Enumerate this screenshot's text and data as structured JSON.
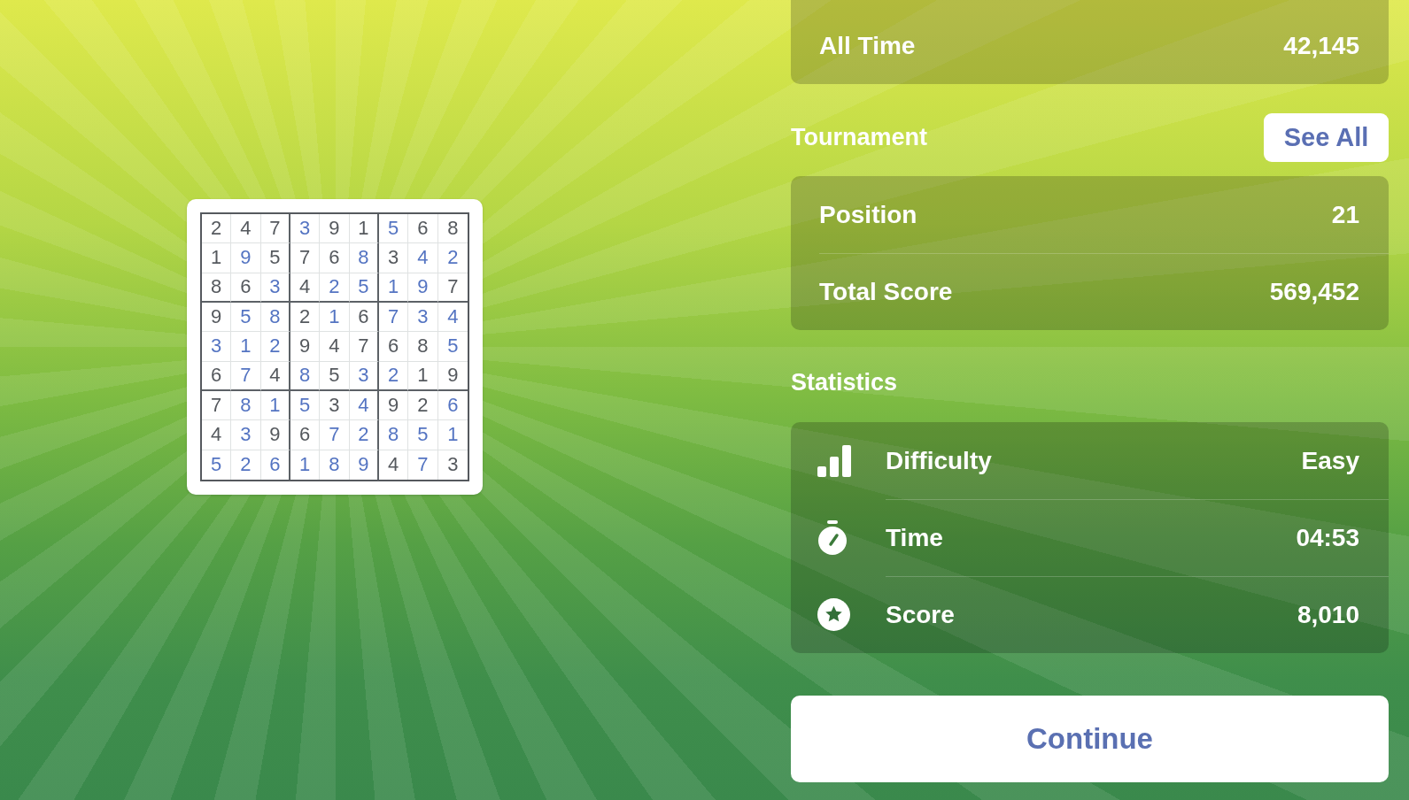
{
  "puzzle": {
    "rows": [
      [
        {
          "digit": "2",
          "given": true
        },
        {
          "digit": "4",
          "given": true
        },
        {
          "digit": "7",
          "given": true
        },
        {
          "digit": "3",
          "given": false
        },
        {
          "digit": "9",
          "given": true
        },
        {
          "digit": "1",
          "given": true
        },
        {
          "digit": "5",
          "given": false
        },
        {
          "digit": "6",
          "given": true
        },
        {
          "digit": "8",
          "given": true
        }
      ],
      [
        {
          "digit": "1",
          "given": true
        },
        {
          "digit": "9",
          "given": false
        },
        {
          "digit": "5",
          "given": true
        },
        {
          "digit": "7",
          "given": true
        },
        {
          "digit": "6",
          "given": true
        },
        {
          "digit": "8",
          "given": false
        },
        {
          "digit": "3",
          "given": true
        },
        {
          "digit": "4",
          "given": false
        },
        {
          "digit": "2",
          "given": false
        }
      ],
      [
        {
          "digit": "8",
          "given": true
        },
        {
          "digit": "6",
          "given": true
        },
        {
          "digit": "3",
          "given": false
        },
        {
          "digit": "4",
          "given": true
        },
        {
          "digit": "2",
          "given": false
        },
        {
          "digit": "5",
          "given": false
        },
        {
          "digit": "1",
          "given": false
        },
        {
          "digit": "9",
          "given": false
        },
        {
          "digit": "7",
          "given": true
        }
      ],
      [
        {
          "digit": "9",
          "given": true
        },
        {
          "digit": "5",
          "given": false
        },
        {
          "digit": "8",
          "given": false
        },
        {
          "digit": "2",
          "given": true
        },
        {
          "digit": "1",
          "given": false
        },
        {
          "digit": "6",
          "given": true
        },
        {
          "digit": "7",
          "given": false
        },
        {
          "digit": "3",
          "given": false
        },
        {
          "digit": "4",
          "given": false
        }
      ],
      [
        {
          "digit": "3",
          "given": false
        },
        {
          "digit": "1",
          "given": false
        },
        {
          "digit": "2",
          "given": false
        },
        {
          "digit": "9",
          "given": true
        },
        {
          "digit": "4",
          "given": true
        },
        {
          "digit": "7",
          "given": true
        },
        {
          "digit": "6",
          "given": true
        },
        {
          "digit": "8",
          "given": true
        },
        {
          "digit": "5",
          "given": false
        }
      ],
      [
        {
          "digit": "6",
          "given": true
        },
        {
          "digit": "7",
          "given": false
        },
        {
          "digit": "4",
          "given": true
        },
        {
          "digit": "8",
          "given": false
        },
        {
          "digit": "5",
          "given": true
        },
        {
          "digit": "3",
          "given": false
        },
        {
          "digit": "2",
          "given": false
        },
        {
          "digit": "1",
          "given": true
        },
        {
          "digit": "9",
          "given": true
        }
      ],
      [
        {
          "digit": "7",
          "given": true
        },
        {
          "digit": "8",
          "given": false
        },
        {
          "digit": "1",
          "given": false
        },
        {
          "digit": "5",
          "given": false
        },
        {
          "digit": "3",
          "given": true
        },
        {
          "digit": "4",
          "given": false
        },
        {
          "digit": "9",
          "given": true
        },
        {
          "digit": "2",
          "given": true
        },
        {
          "digit": "6",
          "given": false
        }
      ],
      [
        {
          "digit": "4",
          "given": true
        },
        {
          "digit": "3",
          "given": false
        },
        {
          "digit": "9",
          "given": true
        },
        {
          "digit": "6",
          "given": true
        },
        {
          "digit": "7",
          "given": false
        },
        {
          "digit": "2",
          "given": false
        },
        {
          "digit": "8",
          "given": false
        },
        {
          "digit": "5",
          "given": false
        },
        {
          "digit": "1",
          "given": false
        }
      ],
      [
        {
          "digit": "5",
          "given": false
        },
        {
          "digit": "2",
          "given": false
        },
        {
          "digit": "6",
          "given": false
        },
        {
          "digit": "1",
          "given": false
        },
        {
          "digit": "8",
          "given": false
        },
        {
          "digit": "9",
          "given": false
        },
        {
          "digit": "4",
          "given": true
        },
        {
          "digit": "7",
          "given": false
        },
        {
          "digit": "3",
          "given": true
        }
      ]
    ]
  },
  "all_time": {
    "label": "All Time",
    "value": "42,145"
  },
  "tournament": {
    "title": "Tournament",
    "see_all_button": "See All",
    "rows": [
      {
        "label": "Position",
        "value": "21"
      },
      {
        "label": "Total Score",
        "value": "569,452"
      }
    ]
  },
  "statistics": {
    "title": "Statistics",
    "rows": [
      {
        "kind": "difficulty",
        "label": "Difficulty",
        "value": "Easy"
      },
      {
        "kind": "time",
        "label": "Time",
        "value": "04:53"
      },
      {
        "kind": "score",
        "label": "Score",
        "value": "8,010"
      }
    ]
  },
  "continue_button": "Continue"
}
